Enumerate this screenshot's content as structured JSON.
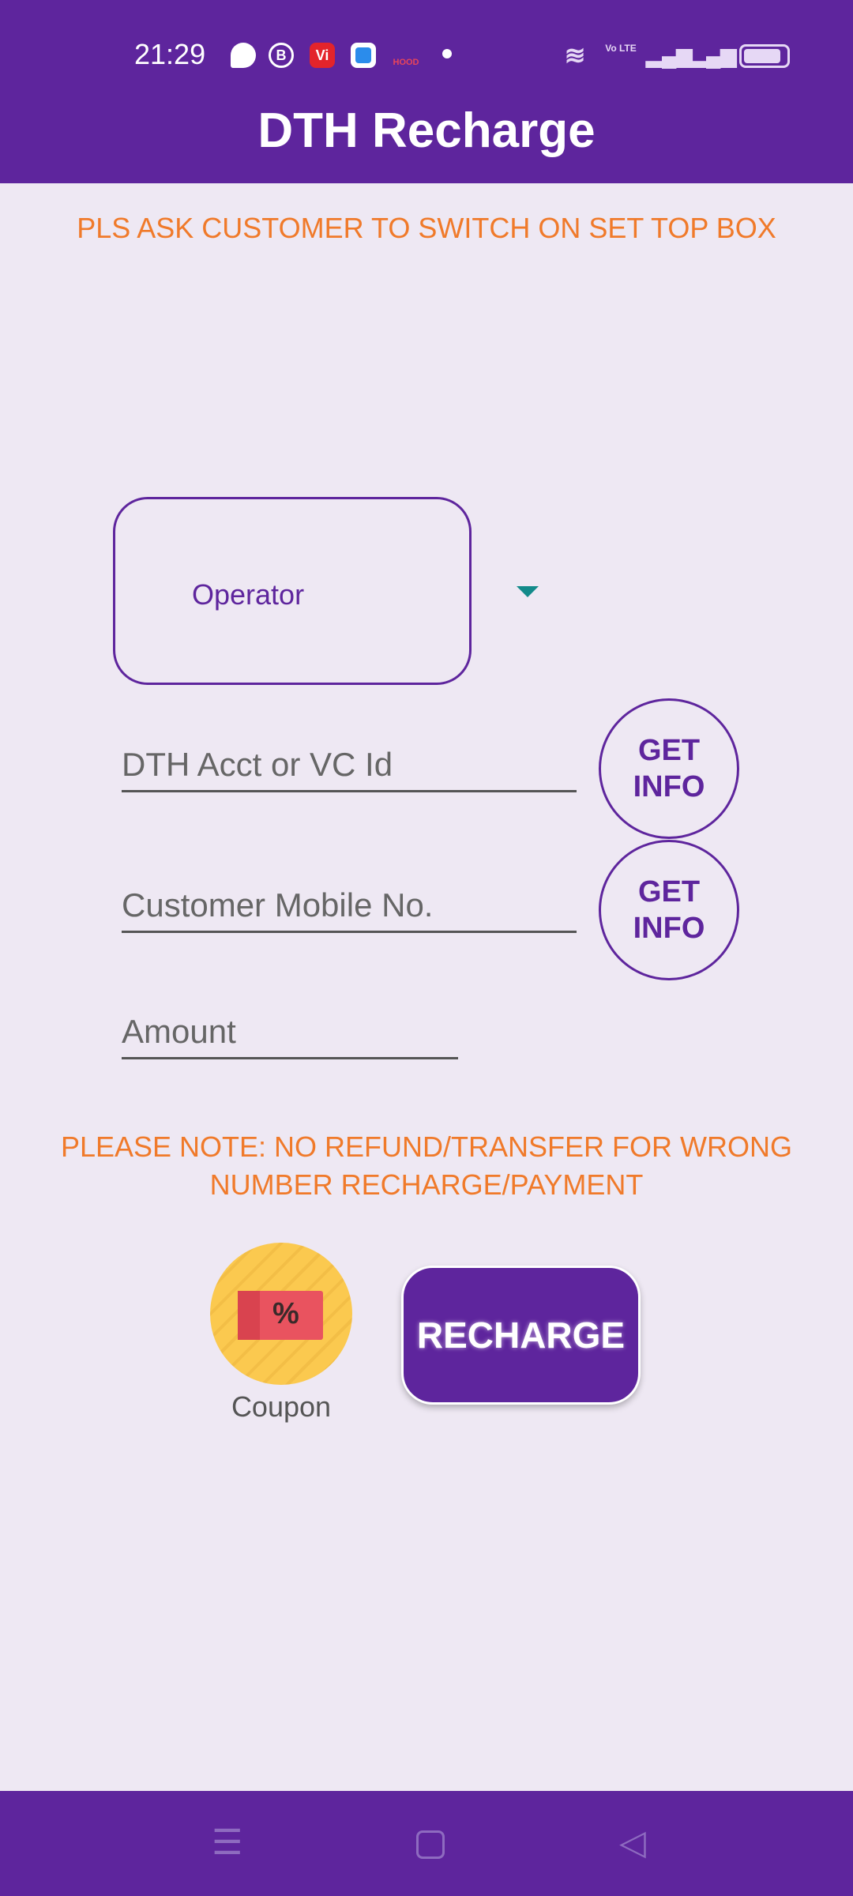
{
  "status_bar": {
    "time": "21:29",
    "icons": [
      "chat-icon",
      "b-icon",
      "vi-icon",
      "app-icon",
      "hood-icon",
      "dot-icon",
      "wifi-icon",
      "volte-icon",
      "signal-icon",
      "signal-icon",
      "battery-icon"
    ],
    "volte_label": "Vo LTE",
    "hood_label": "HOOD",
    "vi_label": "Vi"
  },
  "header": {
    "title": "DTH Recharge"
  },
  "warning": "PLS ASK CUSTOMER TO SWITCH ON SET TOP BOX",
  "form": {
    "operator_label": "Operator",
    "dth_placeholder": "DTH Acct or VC Id",
    "mobile_placeholder": "Customer Mobile No.",
    "amount_placeholder": "Amount",
    "get_info_label": "GET INFO"
  },
  "note": "PLEASE NOTE: NO REFUND/TRANSFER FOR WRONG NUMBER RECHARGE/PAYMENT",
  "coupon": {
    "label": "Coupon",
    "symbol": "%"
  },
  "recharge_label": "RECHARGE",
  "colors": {
    "primary": "#5E259D",
    "warning": "#F07A2A",
    "background": "#EEE8F3"
  }
}
